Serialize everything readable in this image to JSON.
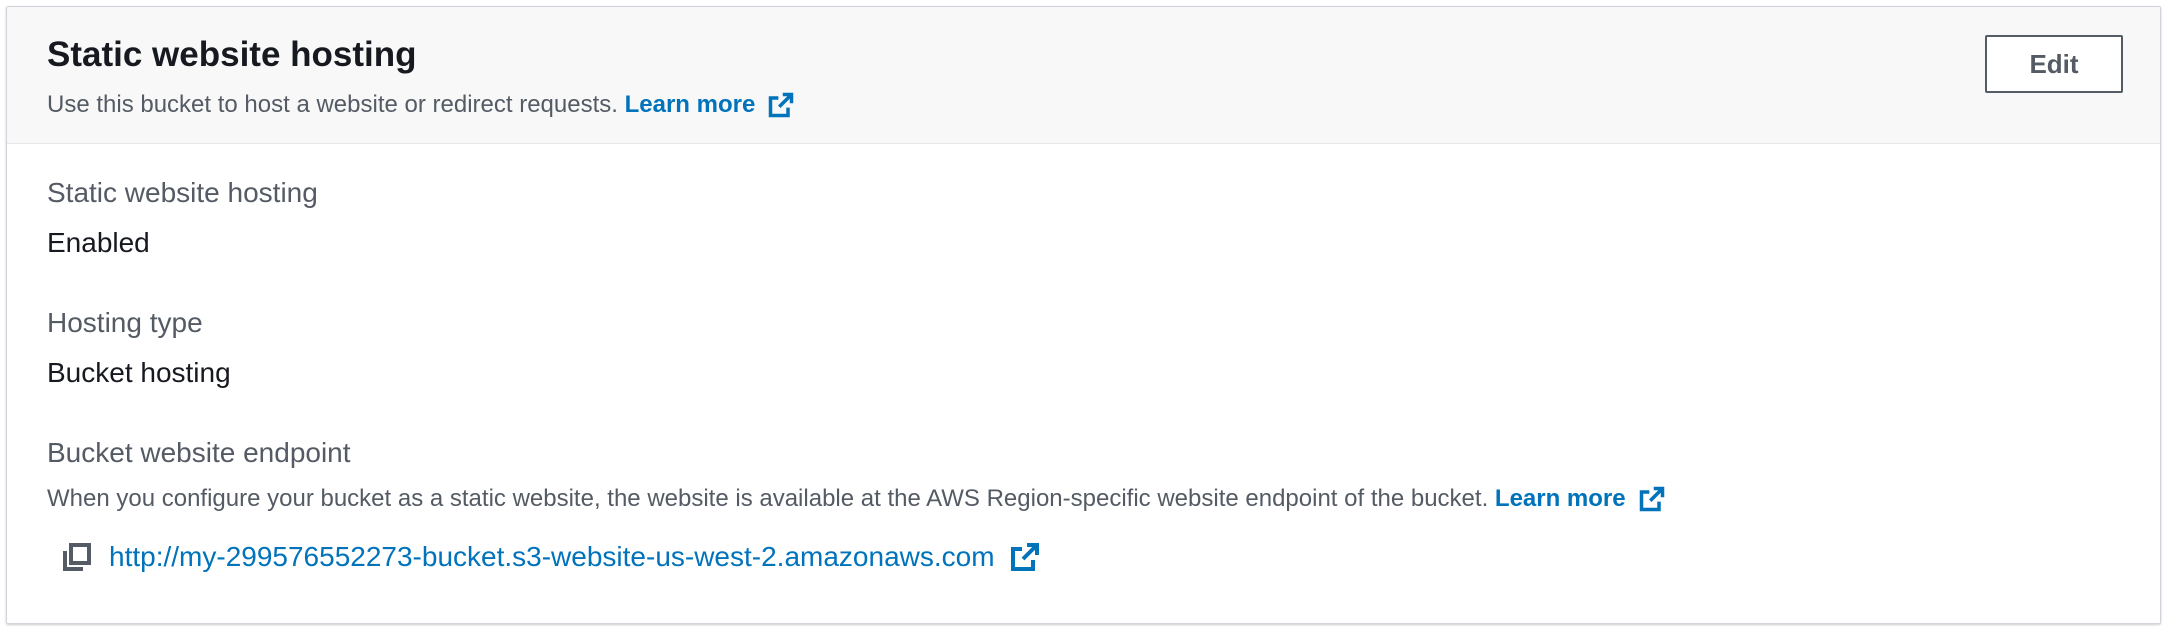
{
  "panel": {
    "title": "Static website hosting",
    "description": "Use this bucket to host a website or redirect requests.",
    "learn_more": "Learn more",
    "edit_label": "Edit"
  },
  "fields": {
    "hosting": {
      "label": "Static website hosting",
      "value": "Enabled"
    },
    "hosting_type": {
      "label": "Hosting type",
      "value": "Bucket hosting"
    },
    "endpoint": {
      "label": "Bucket website endpoint",
      "description": "When you configure your bucket as a static website, the website is available at the AWS Region-specific website endpoint of the bucket.",
      "learn_more": "Learn more",
      "url": "http://my-299576552273-bucket.s3-website-us-west-2.amazonaws.com"
    }
  },
  "icons": {
    "external_link": "external-link-icon",
    "copy": "copy-icon"
  },
  "colors": {
    "link": "#0073bb",
    "title": "#16191f",
    "muted": "#545b64",
    "header_bg": "#f8f8f8"
  }
}
